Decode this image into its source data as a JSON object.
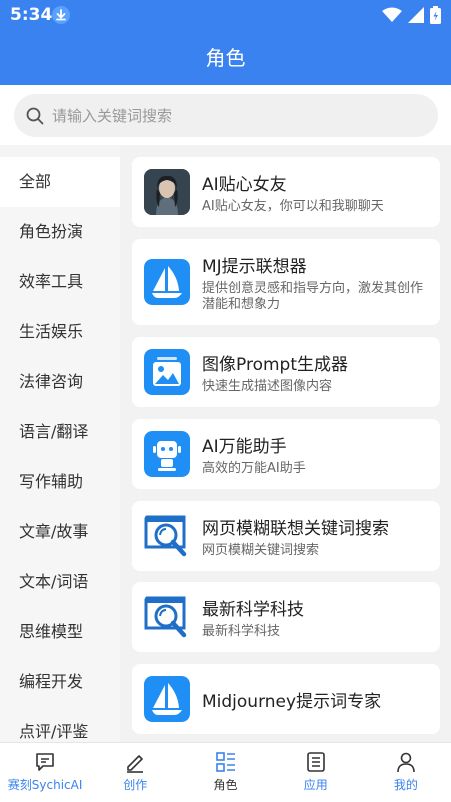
{
  "status_bar": {
    "time": "5:34"
  },
  "header": {
    "title": "角色"
  },
  "search": {
    "placeholder": "请输入关键词搜索"
  },
  "sidebar": {
    "items": [
      {
        "label": "全部",
        "active": true
      },
      {
        "label": "角色扮演"
      },
      {
        "label": "效率工具"
      },
      {
        "label": "生活娱乐"
      },
      {
        "label": "法律咨询"
      },
      {
        "label": "语言/翻译"
      },
      {
        "label": "写作辅助"
      },
      {
        "label": "文章/故事"
      },
      {
        "label": "文本/词语"
      },
      {
        "label": "思维模型"
      },
      {
        "label": "编程开发"
      },
      {
        "label": "点评/评鉴"
      }
    ]
  },
  "cards": [
    {
      "title": "AI贴心女友",
      "desc": "AI贴心女友，你可以和我聊聊天",
      "icon": "portrait-avatar-icon"
    },
    {
      "title": "MJ提示联想器",
      "desc": "提供创意灵感和指导方向，激发其创作潜能和想象力",
      "icon": "sailboat-icon"
    },
    {
      "title": "图像Prompt生成器",
      "desc": "快速生成描述图像内容",
      "icon": "image-gallery-icon"
    },
    {
      "title": "AI万能助手",
      "desc": "高效的万能AI助手",
      "icon": "robot-icon"
    },
    {
      "title": "网页模糊联想关键词搜索",
      "desc": "网页模糊关键词搜索",
      "icon": "web-search-icon"
    },
    {
      "title": "最新科学科技",
      "desc": "最新科学科技",
      "icon": "web-search-icon"
    },
    {
      "title": "Midjourney提示词专家",
      "desc": "",
      "icon": "sailboat-icon"
    }
  ],
  "bottom_nav": {
    "items": [
      {
        "label": "赛刻SychicAI",
        "icon": "chat-icon"
      },
      {
        "label": "创作",
        "icon": "pen-icon"
      },
      {
        "label": "角色",
        "icon": "grid-list-icon",
        "active": true
      },
      {
        "label": "应用",
        "icon": "document-list-icon"
      },
      {
        "label": "我的",
        "icon": "user-icon"
      }
    ]
  },
  "colors": {
    "brand": "#3a82ef",
    "text": "#333333",
    "muted": "#666666"
  }
}
